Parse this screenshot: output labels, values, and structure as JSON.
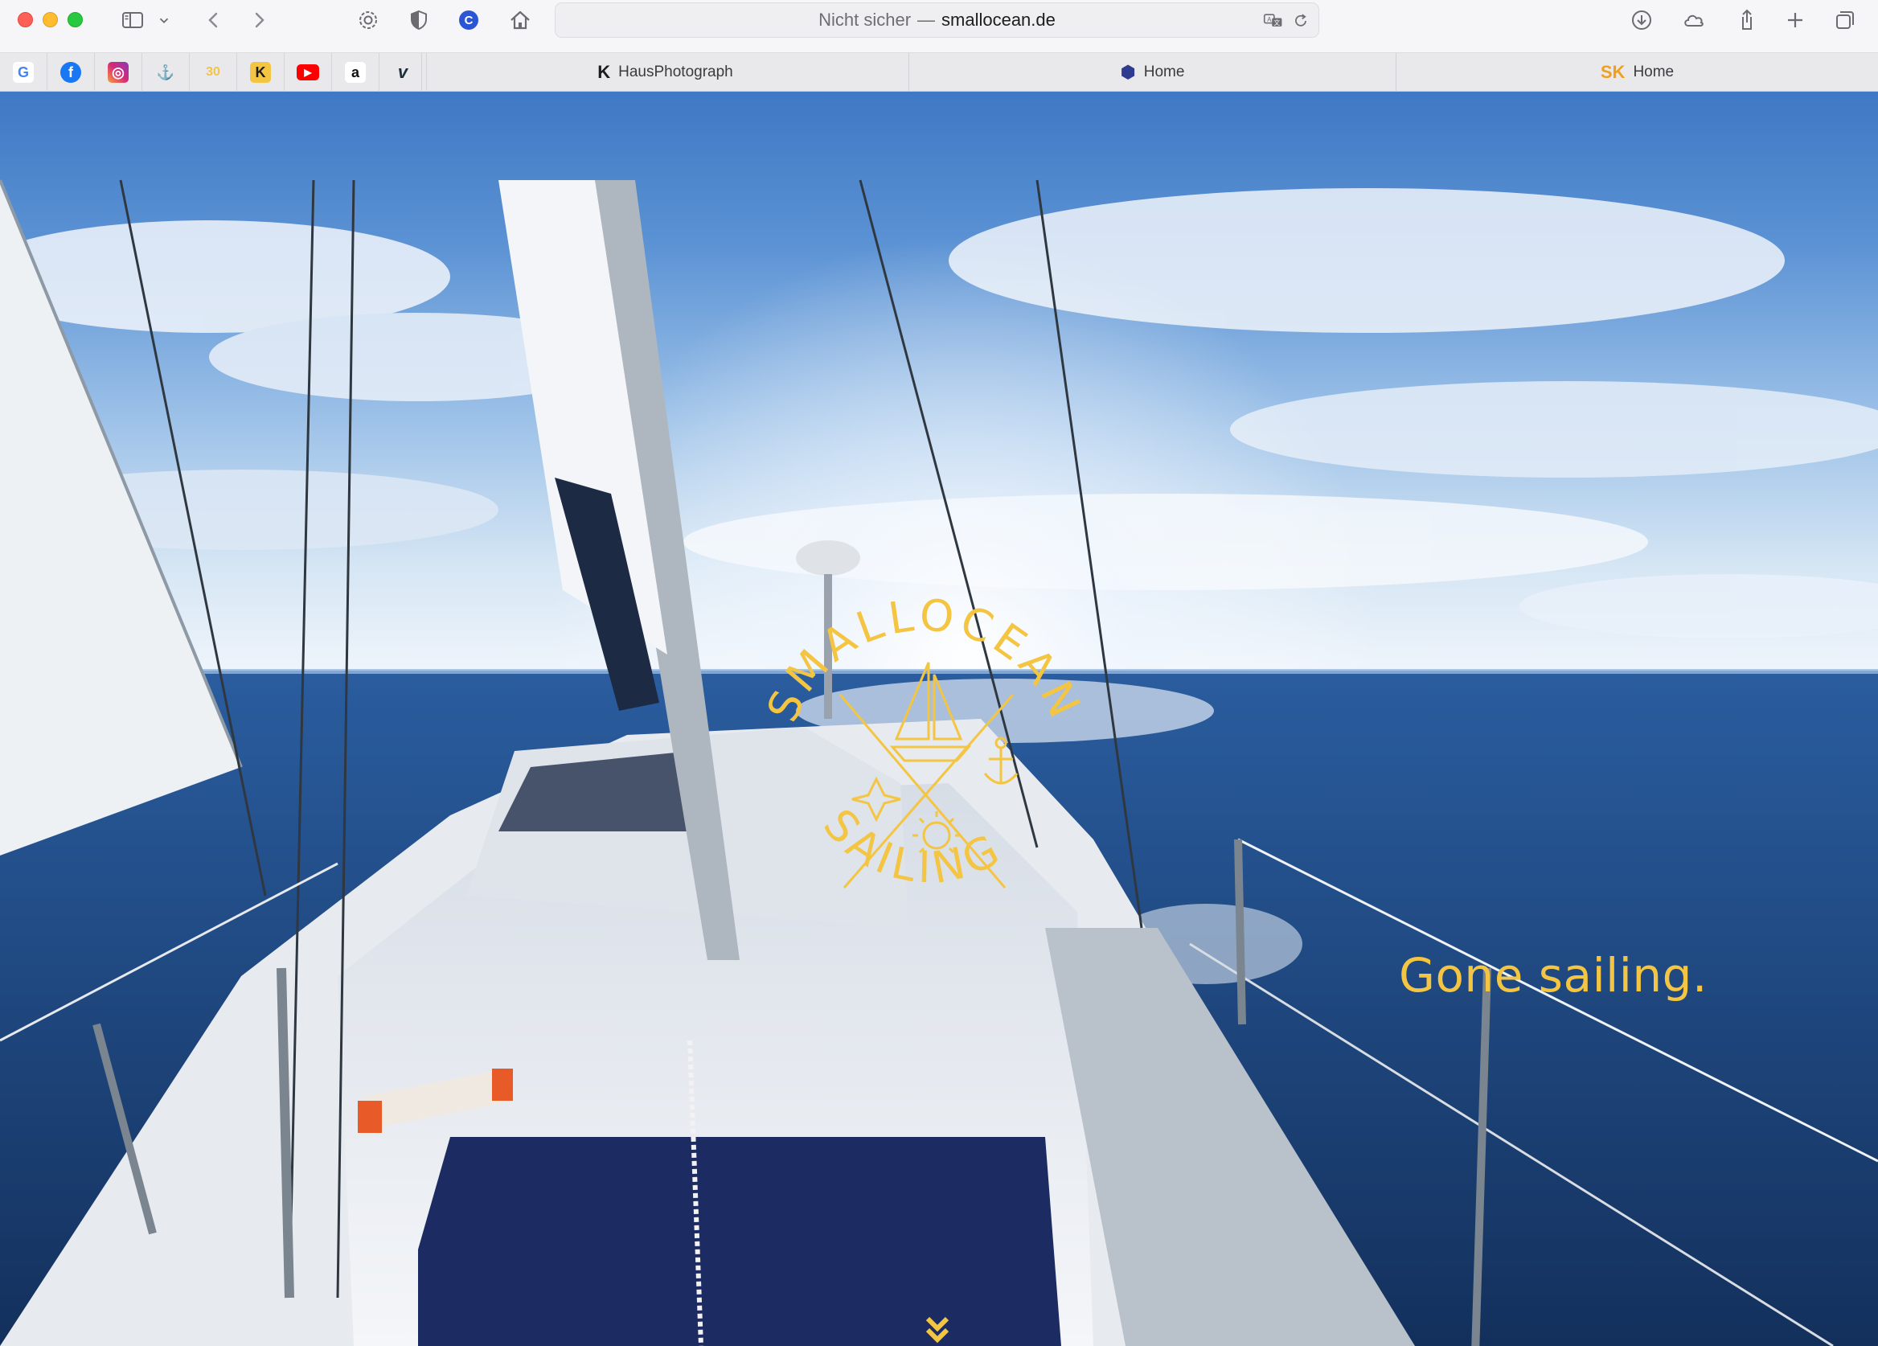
{
  "browser": {
    "address": {
      "security": "Nicht sicher",
      "separator": "—",
      "host": "smallocean.de"
    },
    "favorites": [
      {
        "name": "google",
        "glyph": "G",
        "color": "#4285f4"
      },
      {
        "name": "facebook",
        "glyph": "f",
        "color": "#1877f2"
      },
      {
        "name": "instagram",
        "glyph": "◎",
        "color": "#d62976"
      },
      {
        "name": "anchor",
        "glyph": "⚓",
        "color": "#e2a316"
      },
      {
        "name": "thirty",
        "glyph": "30",
        "color": "#f4c542"
      },
      {
        "name": "k",
        "glyph": "K",
        "color": "#1d1d1f"
      },
      {
        "name": "youtube",
        "glyph": "▶",
        "color": "#ff0000"
      },
      {
        "name": "amazon",
        "glyph": "a",
        "color": "#111111"
      },
      {
        "name": "vimeo",
        "glyph": "v",
        "color": "#1a2e3b"
      }
    ],
    "tabs": [
      {
        "label": "HausPhotograph",
        "icon": "K"
      },
      {
        "label": "Home",
        "icon": "⬢"
      },
      {
        "label": "Home",
        "icon": "SK"
      }
    ]
  },
  "page": {
    "logo": {
      "arc_top": "SMALLOCEAN",
      "arc_bottom": "SAILING",
      "color": "#f4c542"
    },
    "tagline": "Gone sailing.",
    "accent": "#f4c542"
  }
}
